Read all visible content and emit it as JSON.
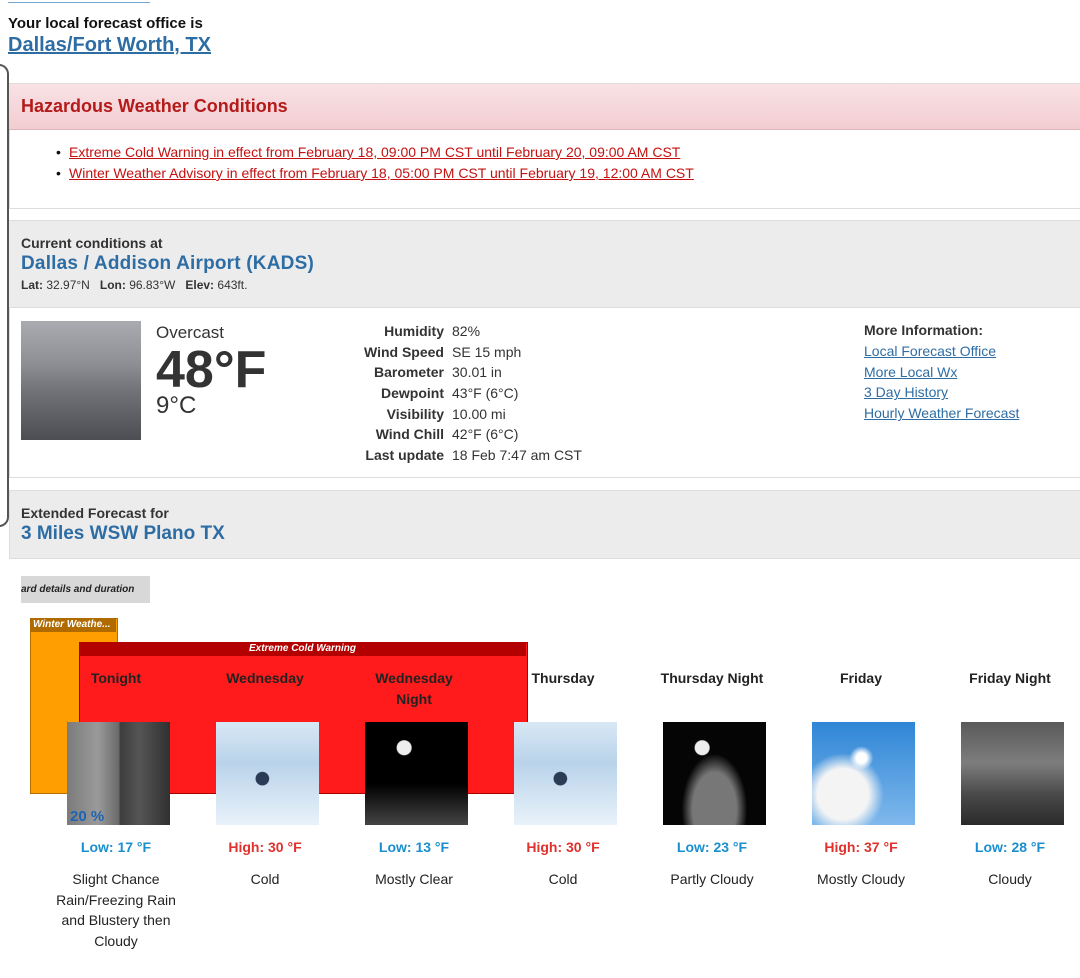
{
  "office": {
    "label": "Your local forecast office is",
    "name": "Dallas/Fort Worth, TX"
  },
  "hazards": {
    "title": "Hazardous Weather Conditions",
    "items": [
      "Extreme Cold Warning in effect from February 18, 09:00 PM CST until February 20, 09:00 AM CST",
      "Winter Weather Advisory in effect from February 18, 05:00 PM CST until February 19, 12:00 AM CST"
    ]
  },
  "current": {
    "label": "Current conditions at",
    "station": "Dallas / Addison Airport (KADS)",
    "lat_label": "Lat:",
    "lat": "32.97°N",
    "lon_label": "Lon:",
    "lon": "96.83°W",
    "elev_label": "Elev:",
    "elev": "643ft.",
    "summary": "Overcast",
    "temp_f": "48°F",
    "temp_c": "9°C",
    "details": [
      {
        "key": "Humidity",
        "value": "82%"
      },
      {
        "key": "Wind Speed",
        "value": "SE 15 mph"
      },
      {
        "key": "Barometer",
        "value": "30.01 in"
      },
      {
        "key": "Dewpoint",
        "value": "43°F (6°C)"
      },
      {
        "key": "Visibility",
        "value": "10.00 mi"
      },
      {
        "key": "Wind Chill",
        "value": "42°F (6°C)"
      },
      {
        "key": "Last update",
        "value": "18 Feb 7:47 am CST"
      }
    ],
    "more_info": {
      "title": "More Information:",
      "links": [
        "Local Forecast Office",
        "More Local Wx",
        "3 Day History",
        "Hourly Weather Forecast"
      ]
    }
  },
  "extended": {
    "label": "Extended Forecast for",
    "place": "3 Miles WSW Plano TX",
    "hazard_tab": "ard details and duration",
    "bars": {
      "winter": "Winter Weathe...",
      "cold": "Extreme Cold Warning"
    },
    "periods": [
      {
        "name": "Tonight",
        "temp": "Low: 17 °F",
        "desc": "Slight Chance Rain/Freezing Rain and Blustery then Cloudy",
        "pop": "20 %",
        "icon": "rain-freezing-rain-icon"
      },
      {
        "name": "Wednesday",
        "temp": "High: 30 °F",
        "desc": "Cold",
        "icon": "cold-icon"
      },
      {
        "name": "Wednesday Night",
        "temp": "Low: 13 °F",
        "desc": "Mostly Clear",
        "icon": "mostly-clear-night-icon"
      },
      {
        "name": "Thursday",
        "temp": "High: 30 °F",
        "desc": "Cold",
        "icon": "cold-icon"
      },
      {
        "name": "Thursday Night",
        "temp": "Low: 23 °F",
        "desc": "Partly Cloudy",
        "icon": "partly-cloudy-night-icon"
      },
      {
        "name": "Friday",
        "temp": "High: 37 °F",
        "desc": "Mostly Cloudy",
        "icon": "mostly-cloudy-icon"
      },
      {
        "name": "Friday Night",
        "temp": "Low: 28 °F",
        "desc": "Cloudy",
        "icon": "cloudy-icon"
      }
    ]
  },
  "colors": {
    "link": "#2e6da4",
    "hazard_red": "#c41111",
    "low_temp": "#1a8fcf",
    "high_temp": "#e0312d",
    "winter_bar": "#ff9e00",
    "cold_bar": "#ff1b1b"
  }
}
